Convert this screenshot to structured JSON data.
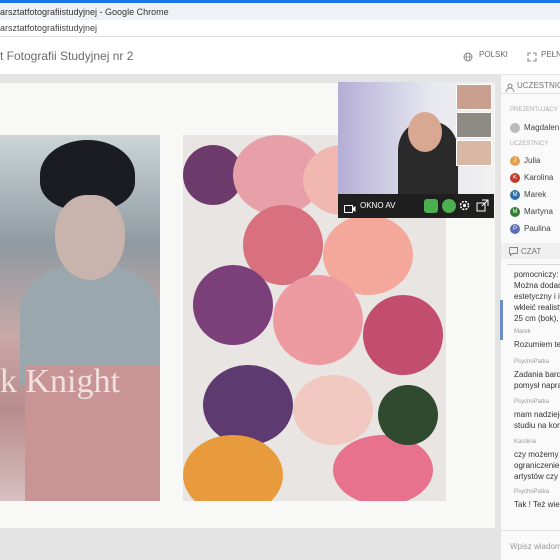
{
  "browser": {
    "window_title": "arsztatfotografiistudyjnej - Google Chrome",
    "url": "arsztatfotografiistudyjnej"
  },
  "header": {
    "room_title": "t Fotografii Studyjnej nr 2",
    "language": "POLSKI",
    "fullscreen": "PEŁN"
  },
  "slide": {
    "image1_caption": "k Knight"
  },
  "video": {
    "label": "OKNO AV"
  },
  "sidebar": {
    "participants_header": "UCZESTNIC",
    "presenters_label": "PREZENTUJĄCY",
    "presenter": "Magdalen",
    "participants_label": "UCZESTNICY",
    "participants": [
      {
        "initial": "J",
        "name": "Julia",
        "color": "#e0a050"
      },
      {
        "initial": "K",
        "name": "Karolina",
        "color": "#c0392b"
      },
      {
        "initial": "M",
        "name": "Marek",
        "color": "#2c6fa8"
      },
      {
        "initial": "M",
        "name": "Martyna",
        "color": "#2e7d32"
      },
      {
        "initial": "P",
        "name": "Paulina",
        "color": "#5b6fb5"
      }
    ],
    "chat_header": "CZAT",
    "messages": [
      {
        "author": "",
        "lines": [
          "pomocniczy:",
          "Można dodać",
          "estetyczny i ir",
          "wkleić realisty",
          "25 cm (bok), 3"
        ]
      },
      {
        "author": "Marek",
        "lines": [
          "Rozumiem te"
        ]
      },
      {
        "author": "PsychoPatka",
        "lines": [
          "Zadania bardz",
          "pomysł napra"
        ]
      },
      {
        "author": "PsychoPatka",
        "lines": [
          "mam nadzieję",
          "studiu na kon"
        ]
      },
      {
        "author": "Karolina",
        "lines": [
          "czy możemy",
          "ograniczenie",
          "artystów czy j"
        ]
      },
      {
        "author": "PsychoPatka",
        "lines": [
          "Tak ! Też wied"
        ]
      }
    ],
    "input_placeholder": "Wpisz wiadom"
  },
  "colors": {
    "chrome_accent": "#1a73e8",
    "stage_bg": "#e4e4e4",
    "video_bar": "#1f1f1f",
    "green_button": "#4caf50"
  }
}
